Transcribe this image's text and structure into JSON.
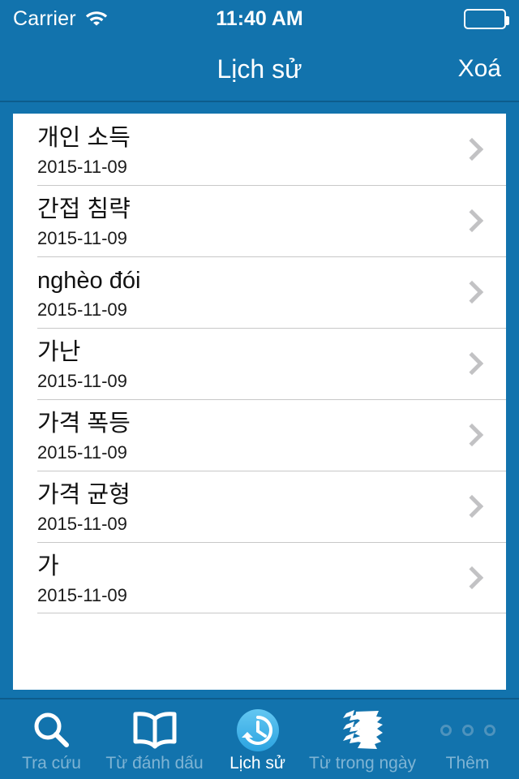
{
  "status_bar": {
    "carrier": "Carrier",
    "wifi_icon": "wifi-icon",
    "time": "11:40 AM",
    "battery_icon": "battery-icon"
  },
  "nav_bar": {
    "title": "Lịch sử",
    "action_label": "Xoá"
  },
  "colors": {
    "brand_blue": "#1273ad",
    "nav_border": "#0d5c8c",
    "card_bg": "#ffffff",
    "separator": "#c8c8c8",
    "chevron": "#c2c2c4",
    "tab_inactive": "#7fb4d4",
    "tab_active": "#ffffff",
    "active_icon_cyan": "#45b6ec"
  },
  "history_list": {
    "rows": [
      {
        "title": "개인 소득",
        "date": "2015-11-09",
        "chevron": "chevron-right-icon"
      },
      {
        "title": "간접 침략",
        "date": "2015-11-09",
        "chevron": "chevron-right-icon"
      },
      {
        "title": "nghèo đói",
        "date": "2015-11-09",
        "chevron": "chevron-right-icon"
      },
      {
        "title": "가난",
        "date": "2015-11-09",
        "chevron": "chevron-right-icon"
      },
      {
        "title": "가격 폭등",
        "date": "2015-11-09",
        "chevron": "chevron-right-icon"
      },
      {
        "title": "가격 균형",
        "date": "2015-11-09",
        "chevron": "chevron-right-icon"
      },
      {
        "title": "가",
        "date": "2015-11-09",
        "chevron": "chevron-right-icon"
      }
    ]
  },
  "tab_bar": {
    "tabs": [
      {
        "label": "Tra cứu",
        "icon": "search-icon",
        "active": false
      },
      {
        "label": "Từ đánh dấu",
        "icon": "open-book-icon",
        "active": false
      },
      {
        "label": "Lịch sử",
        "icon": "history-clock-icon",
        "active": true
      },
      {
        "label": "Từ trong ngày",
        "icon": "stacked-pages-icon",
        "active": false
      },
      {
        "label": "Thêm",
        "icon": "more-dots-icon",
        "active": false
      }
    ]
  }
}
